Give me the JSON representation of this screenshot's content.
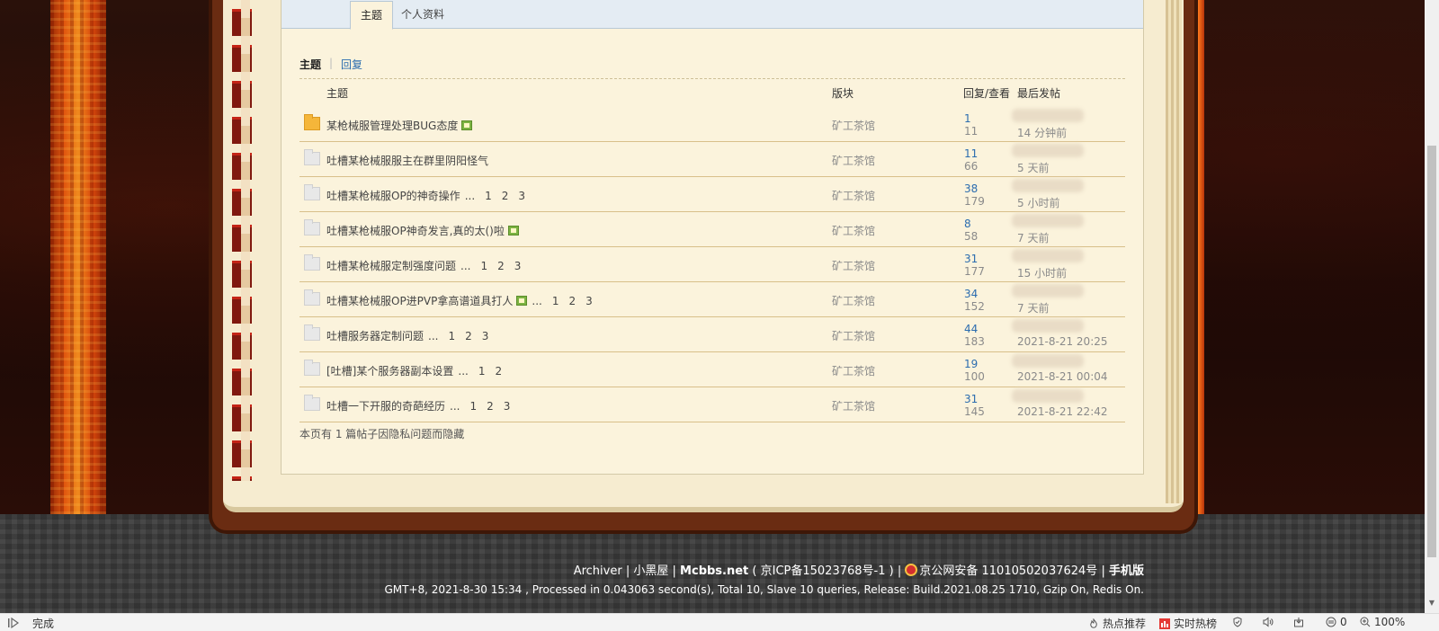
{
  "tabs": {
    "topics": "主题",
    "profile": "个人资料"
  },
  "sub_tabs": {
    "topics": "主题",
    "separator": "|",
    "replies": "回复"
  },
  "table": {
    "headers": {
      "title": "主题",
      "forum": "版块",
      "stats": "回复/查看",
      "last_post": "最后发帖"
    },
    "rows": [
      {
        "title": "某枪械服管理处理BUG态度",
        "has_image": true,
        "pages": [],
        "forum": "矿工茶馆",
        "replies": "1",
        "views": "11",
        "last_time": "14 分钟前",
        "is_new": true
      },
      {
        "title": "吐槽某枪械服服主在群里阴阳怪气",
        "has_image": false,
        "pages": [],
        "forum": "矿工茶馆",
        "replies": "11",
        "views": "66",
        "last_time": "5 天前",
        "is_new": false
      },
      {
        "title": "吐槽某枪械服OP的神奇操作",
        "has_image": false,
        "pages": [
          "1",
          "2",
          "3"
        ],
        "forum": "矿工茶馆",
        "replies": "38",
        "views": "179",
        "last_time": "5 小时前",
        "is_new": false
      },
      {
        "title": "吐槽某枪械服OP神奇发言,真的太()啦",
        "has_image": true,
        "pages": [],
        "forum": "矿工茶馆",
        "replies": "8",
        "views": "58",
        "last_time": "7 天前",
        "is_new": false
      },
      {
        "title": "吐槽某枪械服定制强度问题",
        "has_image": false,
        "pages": [
          "1",
          "2",
          "3"
        ],
        "forum": "矿工茶馆",
        "replies": "31",
        "views": "177",
        "last_time": "15 小时前",
        "is_new": false
      },
      {
        "title": "吐槽某枪械服OP进PVP拿高谱道具打人",
        "has_image": true,
        "pages": [
          "1",
          "2",
          "3"
        ],
        "forum": "矿工茶馆",
        "replies": "34",
        "views": "152",
        "last_time": "7 天前",
        "is_new": false
      },
      {
        "title": "吐槽服务器定制问题",
        "has_image": false,
        "pages": [
          "1",
          "2",
          "3"
        ],
        "forum": "矿工茶馆",
        "replies": "44",
        "views": "183",
        "last_time": "2021-8-21 20:25",
        "is_new": false
      },
      {
        "title": "[吐槽]某个服务器副本设置",
        "has_image": false,
        "pages": [
          "1",
          "2"
        ],
        "forum": "矿工茶馆",
        "replies": "19",
        "views": "100",
        "last_time": "2021-8-21 00:04",
        "is_new": false
      },
      {
        "title": "吐槽一下开服的奇葩经历",
        "has_image": false,
        "pages": [
          "1",
          "2",
          "3"
        ],
        "forum": "矿工茶馆",
        "replies": "31",
        "views": "145",
        "last_time": "2021-8-21 22:42",
        "is_new": false
      }
    ]
  },
  "hidden_note": "本页有 1 篇帖子因隐私问题而隐藏",
  "footer": {
    "archiver": "Archiver",
    "sep": "|",
    "dark_room": "小黑屋",
    "brand": "Mcbbs.net",
    "icp": "( 京ICP备15023768号-1 )",
    "police": "京公网安备 11010502037624号",
    "mobile": "手机版",
    "info": "GMT+8, 2021-8-30 15:34 , Processed in 0.043063 second(s), Total 10, Slave 10 queries, Release: Build.2021.08.25 1710, Gzip On, Redis On."
  },
  "status_bar": {
    "status": "完成",
    "hot": "热点推荐",
    "realtime": "实时热榜",
    "adblock_count": "0",
    "zoom": "100%"
  },
  "colors": {
    "link_blue": "#2b6caf",
    "tab_bg": "#e4ecf3",
    "page_bg": "#fbf3dc",
    "row_border": "#d8bf8a"
  }
}
